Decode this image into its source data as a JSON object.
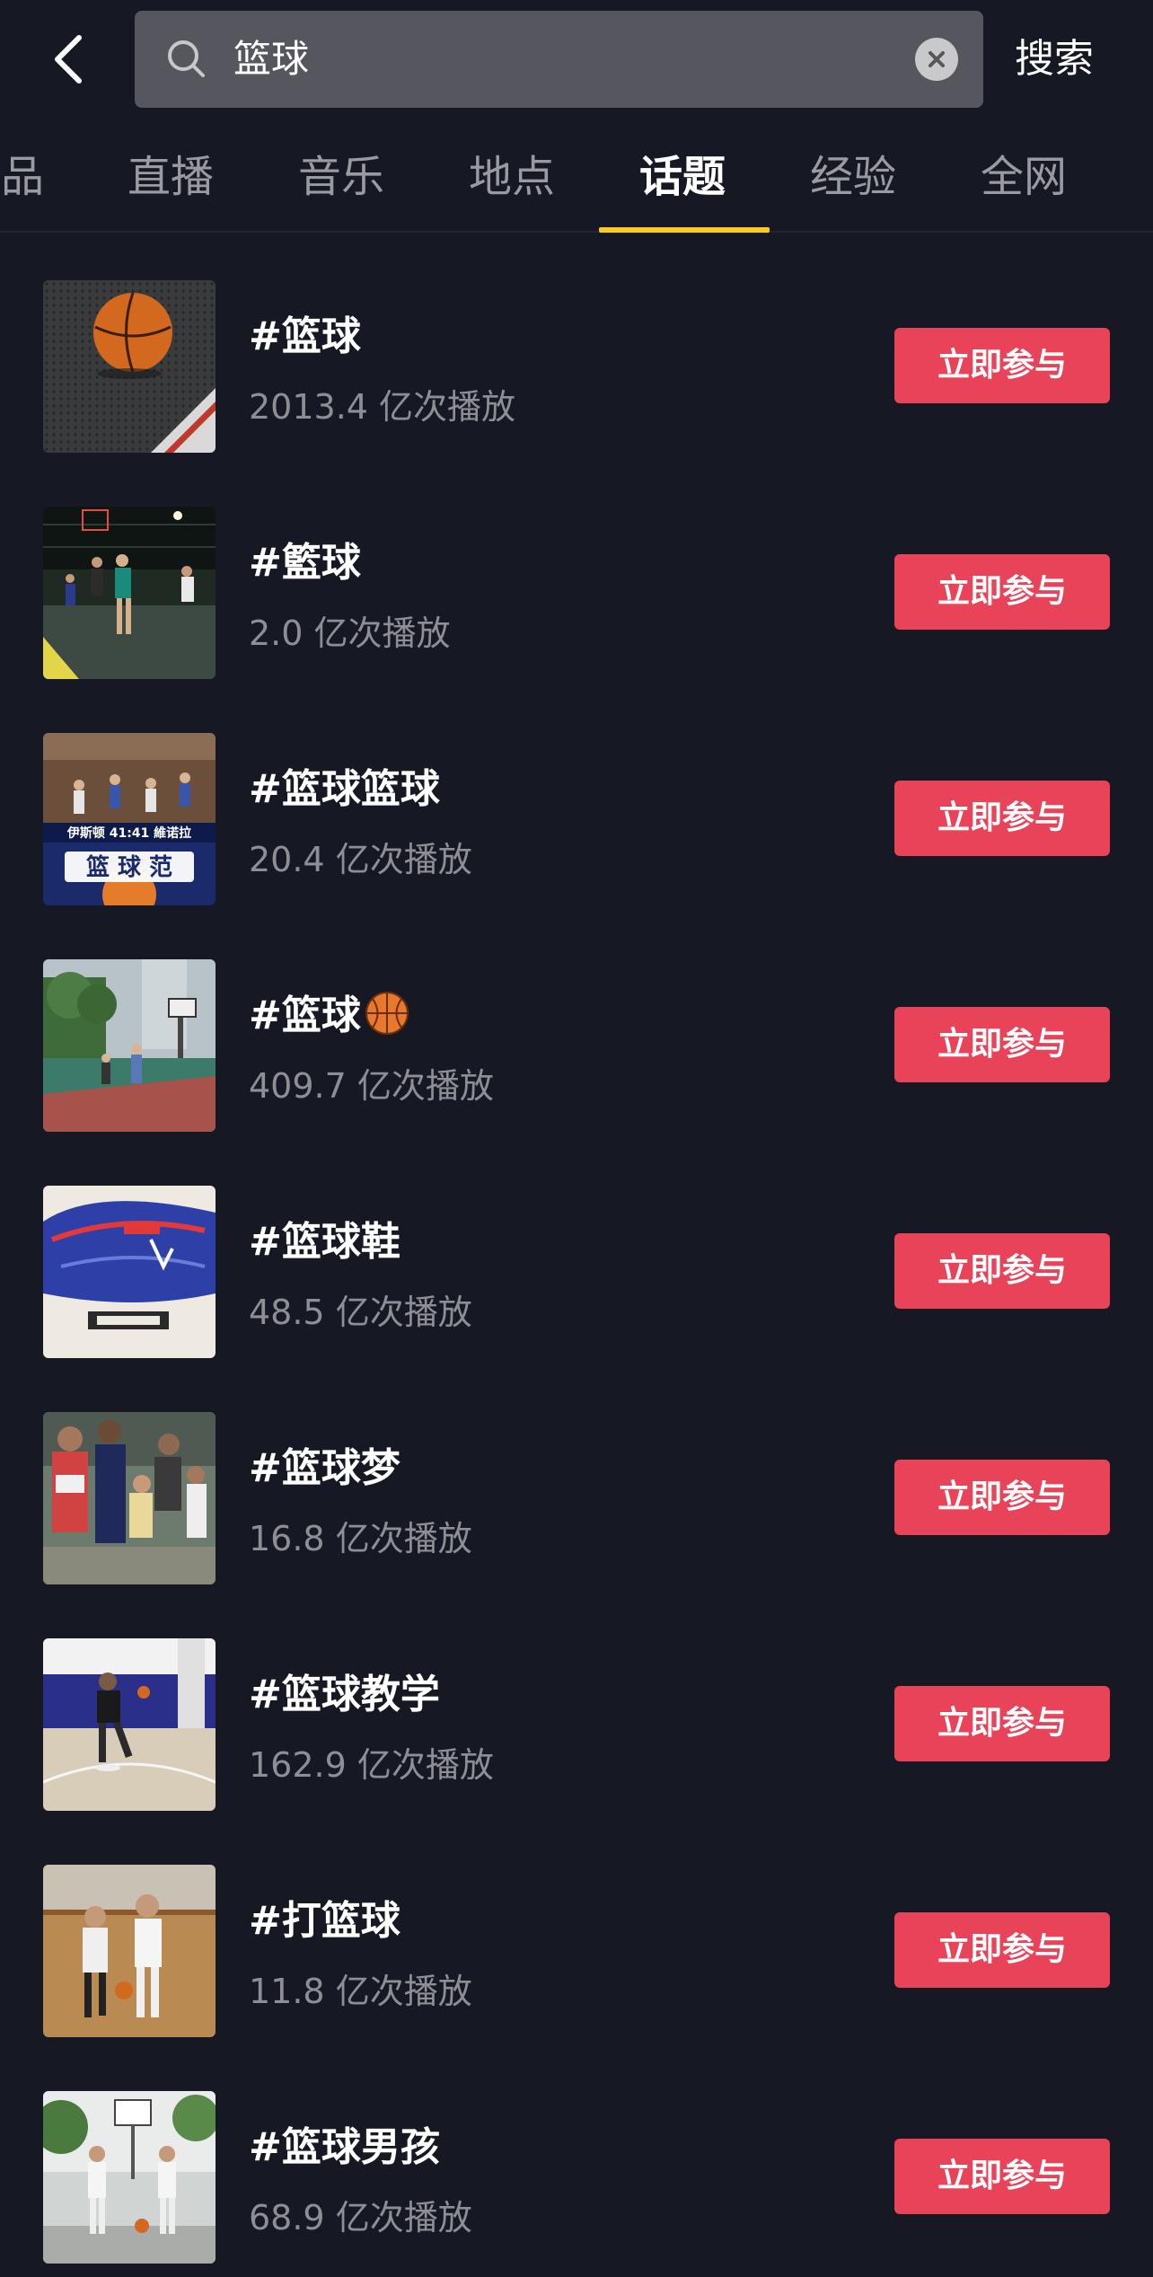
{
  "search": {
    "query": "篮球",
    "action_label": "搜索"
  },
  "tabs": [
    {
      "label": "品"
    },
    {
      "label": "直播"
    },
    {
      "label": "音乐"
    },
    {
      "label": "地点"
    },
    {
      "label": "话题",
      "active": true
    },
    {
      "label": "经验"
    },
    {
      "label": "全网"
    }
  ],
  "topics": [
    {
      "title": "#篮球",
      "plays": "2013.4 亿次播放",
      "button": "立即参与"
    },
    {
      "title": "#籃球",
      "plays": "2.0 亿次播放",
      "button": "立即参与"
    },
    {
      "title": "#篮球篮球",
      "plays": "20.4 亿次播放",
      "button": "立即参与"
    },
    {
      "title": "#篮球",
      "plays": "409.7 亿次播放",
      "button": "立即参与",
      "emoji": "basketball-icon"
    },
    {
      "title": "#篮球鞋",
      "plays": "48.5 亿次播放",
      "button": "立即参与"
    },
    {
      "title": "#篮球梦",
      "plays": "16.8 亿次播放",
      "button": "立即参与"
    },
    {
      "title": "#篮球教学",
      "plays": "162.9 亿次播放",
      "button": "立即参与"
    },
    {
      "title": "#打篮球",
      "plays": "11.8 亿次播放",
      "button": "立即参与"
    },
    {
      "title": "#篮球男孩",
      "plays": "68.9 亿次播放",
      "button": "立即参与"
    }
  ],
  "thumb_texts": {
    "scoreboard": "伊斯顿 41:41 維诺拉",
    "logo": "篮 球 范"
  },
  "colors": {
    "background": "#161823",
    "accent_underline": "#face15",
    "join_button": "#e94359",
    "search_box": "#56575e"
  }
}
